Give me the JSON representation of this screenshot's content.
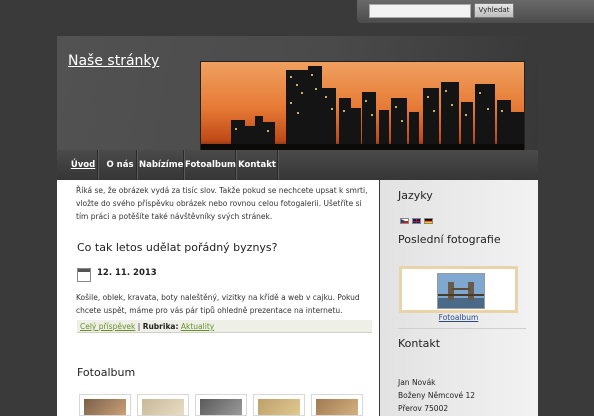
{
  "search": {
    "placeholder": "",
    "button_label": "Vyhledat"
  },
  "header": {
    "site_title": "Naše stránky"
  },
  "nav": {
    "items": [
      "Úvod",
      "O nás",
      "Nabízíme",
      "Fotoalbum",
      "Kontakt"
    ]
  },
  "intro": {
    "text": "Říká se, že obrázek vydá za tisíc slov. Takže pokud se nechcete upsat k smrti, vložte do svého příspěvku obrázek nebo rovnou celou fotogalerii. Ušetříte si tím práci a potěšíte také návštěvníky svých stránek."
  },
  "post": {
    "title": "Co tak letos udělat pořádný byznys?",
    "date": "12. 11. 2013",
    "body": "Košile, oblek, kravata, boty naleštěný, vizitky na křídě a web v cajku. Pokud chcete uspět, máme pro vás pár tipů ohledně prezentace na internetu.",
    "read_more": "Celý příspěvek",
    "separator": "|",
    "category_label": "Rubrika:",
    "category": "Aktuality"
  },
  "album": {
    "title": "Fotoalbum"
  },
  "sidebar": {
    "languages_title": "Jazyky",
    "photos_title": "Poslední fotografie",
    "photo_caption": "Fotoalbum",
    "contact_title": "Kontakt",
    "contact_lines": [
      "Jan Novák",
      "Boženy Němcové 12",
      "Přerov 75002"
    ]
  },
  "colors": {
    "link": "#6a8e2a",
    "photo_frame": "#e8d4a8",
    "dark_bg": "#3a3a3a"
  }
}
